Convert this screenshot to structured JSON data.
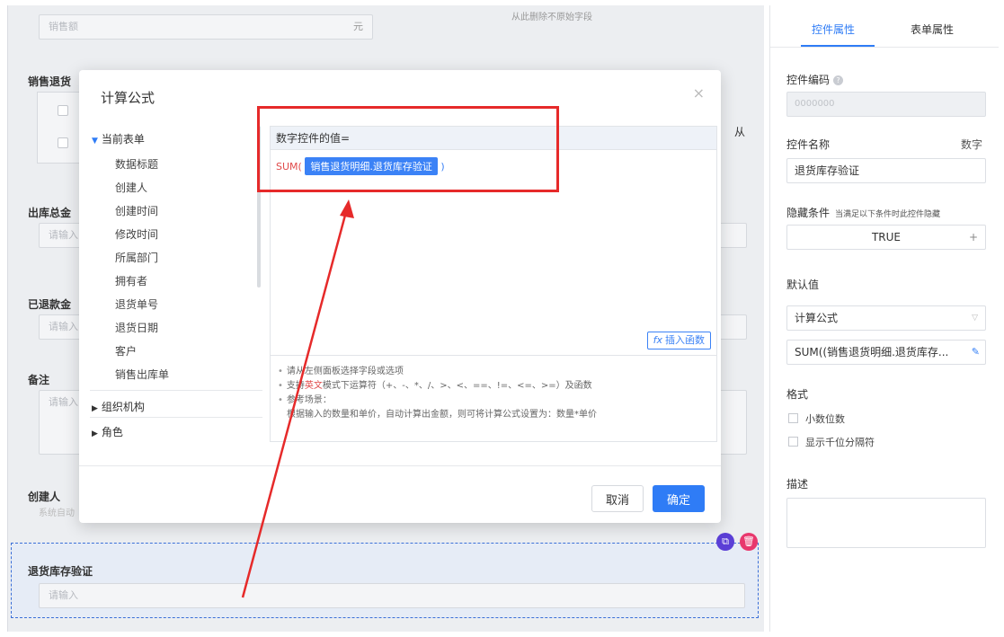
{
  "background_form": {
    "top_input_placeholder": "销售额",
    "top_input_suffix": "元",
    "top_center_note": "从此删除不原始字段",
    "section_sales_return": "销售退货",
    "from_label": "从",
    "total_out_label": "出库总金",
    "total_out_placeholder": "请输入",
    "refunded_label": "已退款金",
    "refunded_placeholder": "请输入",
    "remark_label": "备注",
    "remark_placeholder": "请输入",
    "creator_label": "创建人",
    "creator_sub": "系统自动",
    "return_stock_label": "退货库存验证",
    "return_stock_placeholder": "请输入"
  },
  "modal": {
    "title": "计算公式",
    "close": "×",
    "tree": {
      "current_form": "当前表单",
      "fields": [
        "数据标题",
        "创建人",
        "创建时间",
        "修改时间",
        "所属部门",
        "拥有者",
        "退货单号",
        "退货日期",
        "客户",
        "销售出库单"
      ],
      "org": "组织机构",
      "role": "角色"
    },
    "editor": {
      "header": "数字控件的值=",
      "fn": "SUM(",
      "field_chip": "销售退货明细.退货库存验证",
      "close_paren": ")",
      "insert_fn": "插入函数",
      "hints": [
        "请从左侧面板选择字段或选项",
        "支持英文模式下运算符（+、-、*、/、>、<、==、!=、<=、>=）及函数",
        "参考场景：",
        "根据输入的数量和单价，自动计算出金额，则可将计算公式设置为：数量*单价"
      ],
      "hint_red_word": "英文"
    },
    "cancel": "取消",
    "ok": "确定"
  },
  "right_panel": {
    "tabs": [
      "控件属性",
      "表单属性"
    ],
    "control_code_label": "控件编码",
    "control_code_value": "0000000",
    "control_name_label": "控件名称",
    "control_type": "数字",
    "control_name_value": "退货库存验证",
    "hide_cond_label": "隐藏条件",
    "hide_cond_desc": "当满足以下条件时此控件隐藏",
    "hide_cond_value": "TRUE",
    "default_label": "默认值",
    "default_type": "计算公式",
    "default_formula": "SUM((销售退货明细.退货库存...",
    "format_label": "格式",
    "decimal": "小数位数",
    "thousand_sep": "显示千位分隔符",
    "desc_label": "描述"
  },
  "colors": {
    "primary": "#2f7cf6",
    "annotation_red": "#e62a2a",
    "chip_blue": "#3b82f6"
  }
}
